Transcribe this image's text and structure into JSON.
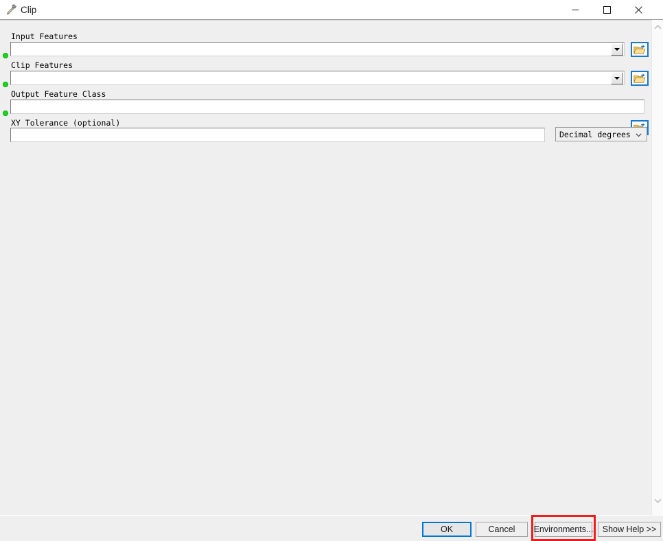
{
  "window": {
    "title": "Clip",
    "icon": "hammer-tool-icon",
    "controls": {
      "minimize": "–",
      "maximize": "□",
      "close": "✕"
    }
  },
  "parameters": [
    {
      "label": "Input Features",
      "required": true,
      "control": "combobox",
      "value": "",
      "browse_icon": "open-folder-add-icon"
    },
    {
      "label": "Clip Features",
      "required": true,
      "control": "combobox",
      "value": "",
      "browse_icon": "open-folder-add-icon"
    },
    {
      "label": "Output Feature Class",
      "required": true,
      "control": "textbox",
      "value": "",
      "browse_icon": "open-folder-add-icon"
    },
    {
      "label": "XY Tolerance (optional)",
      "required": false,
      "control": "textbox-with-units",
      "value": "",
      "units_value": "Decimal degrees"
    }
  ],
  "scrollbar": {
    "up_icon": "chevron-up-icon",
    "down_icon": "chevron-down-icon"
  },
  "footer": {
    "buttons": [
      {
        "label": "OK",
        "name": "ok-button",
        "default": true
      },
      {
        "label": "Cancel",
        "name": "cancel-button",
        "default": false
      },
      {
        "label": "Environments...",
        "name": "environments-button",
        "default": false
      },
      {
        "label": "Show Help >>",
        "name": "show-help-button",
        "default": false
      }
    ]
  },
  "annotation": {
    "type": "highlight-rectangle",
    "target": "Environments...",
    "color": "#ee1c1c"
  },
  "colors": {
    "window_background": "#ffffff",
    "panel_background": "#efefef",
    "required_bullet": "#12dd12",
    "focus_border": "#0078d7",
    "browse_border": "#1778cf",
    "annotation": "#ee1c1c"
  }
}
